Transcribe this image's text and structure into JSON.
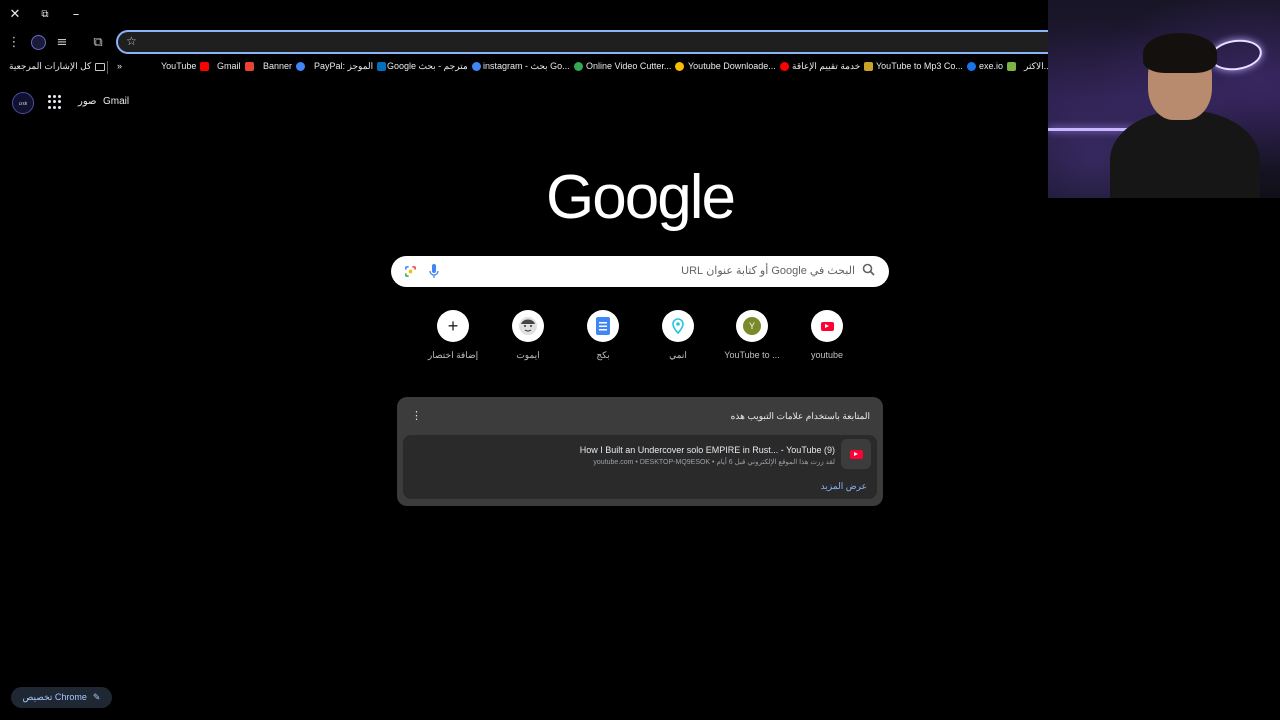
{
  "window": {
    "close_glyph": "✕",
    "restore_glyph": "⧉",
    "minimize_glyph": "–"
  },
  "toolbar": {
    "menu_glyph": "⋮",
    "reading_list_glyph": "≡",
    "extensions_glyph": "⧉",
    "star_glyph": "☆"
  },
  "bookmarks": {
    "all_bookmarks": "كل الإشارات المرجعية",
    "overflow": "»",
    "items": [
      {
        "label": "YouTube",
        "color": "#ff0000"
      },
      {
        "label": "Gmail",
        "color": "#ea4335"
      },
      {
        "label": "Banner",
        "color": "#4285f4"
      },
      {
        "label": "PayPal: الموجز",
        "color": "#0070ba"
      },
      {
        "label": "Google مترجم - بحث",
        "color": "#4285f4"
      },
      {
        "label": "instagram - بحث Go...",
        "color": "#34a853"
      },
      {
        "label": "Online Video Cutter...",
        "color": "#fbbc05"
      },
      {
        "label": "Youtube Downloade...",
        "color": "#ff0000"
      },
      {
        "label": "خدمة تقييم الإعاقة",
        "color": "#c9a227"
      },
      {
        "label": "YouTube to Mp3 Co...",
        "color": "#1a73e8"
      },
      {
        "label": "exe.io",
        "color": "#7cb342"
      },
      {
        "label": "الاكثر...",
        "color": "#9aa0a6"
      }
    ]
  },
  "ntp_header": {
    "avatar_text": "crsh",
    "images": "صور",
    "gmail": "Gmail"
  },
  "logo": "Google",
  "search": {
    "placeholder": "البحث في Google أو كتابة عنوان URL"
  },
  "shortcuts": [
    {
      "label": "youtube",
      "icon": "youtube-icon",
      "color": "#ff0033"
    },
    {
      "label": "YouTube to ...",
      "icon": "y-letter-icon",
      "color": "#7a8a2a"
    },
    {
      "label": "انمي",
      "icon": "location-pin-icon",
      "color": "#26c6da"
    },
    {
      "label": "بكج",
      "icon": "docs-icon",
      "color": "#4285f4"
    },
    {
      "label": "ايموت",
      "icon": "face-icon",
      "color": "#5f6368"
    },
    {
      "label": "إضافة اختصار",
      "icon": "plus-icon",
      "color": "#202124"
    }
  ],
  "journey": {
    "title": "المتابعة باستخدام علامات التبويب هذه",
    "item_title": "How I Built an Undercover solo EMPIRE in Rust... - YouTube (9)",
    "item_sub": "youtube.com • DESKTOP-MQ9ESOK • لقد زرت هذا الموقع الإلكتروني قبل 6 أيام",
    "show_more": "عرض المزيد",
    "menu_glyph": "⋮"
  },
  "customize": {
    "label": "تخصيص Chrome",
    "pencil_glyph": "✎"
  }
}
